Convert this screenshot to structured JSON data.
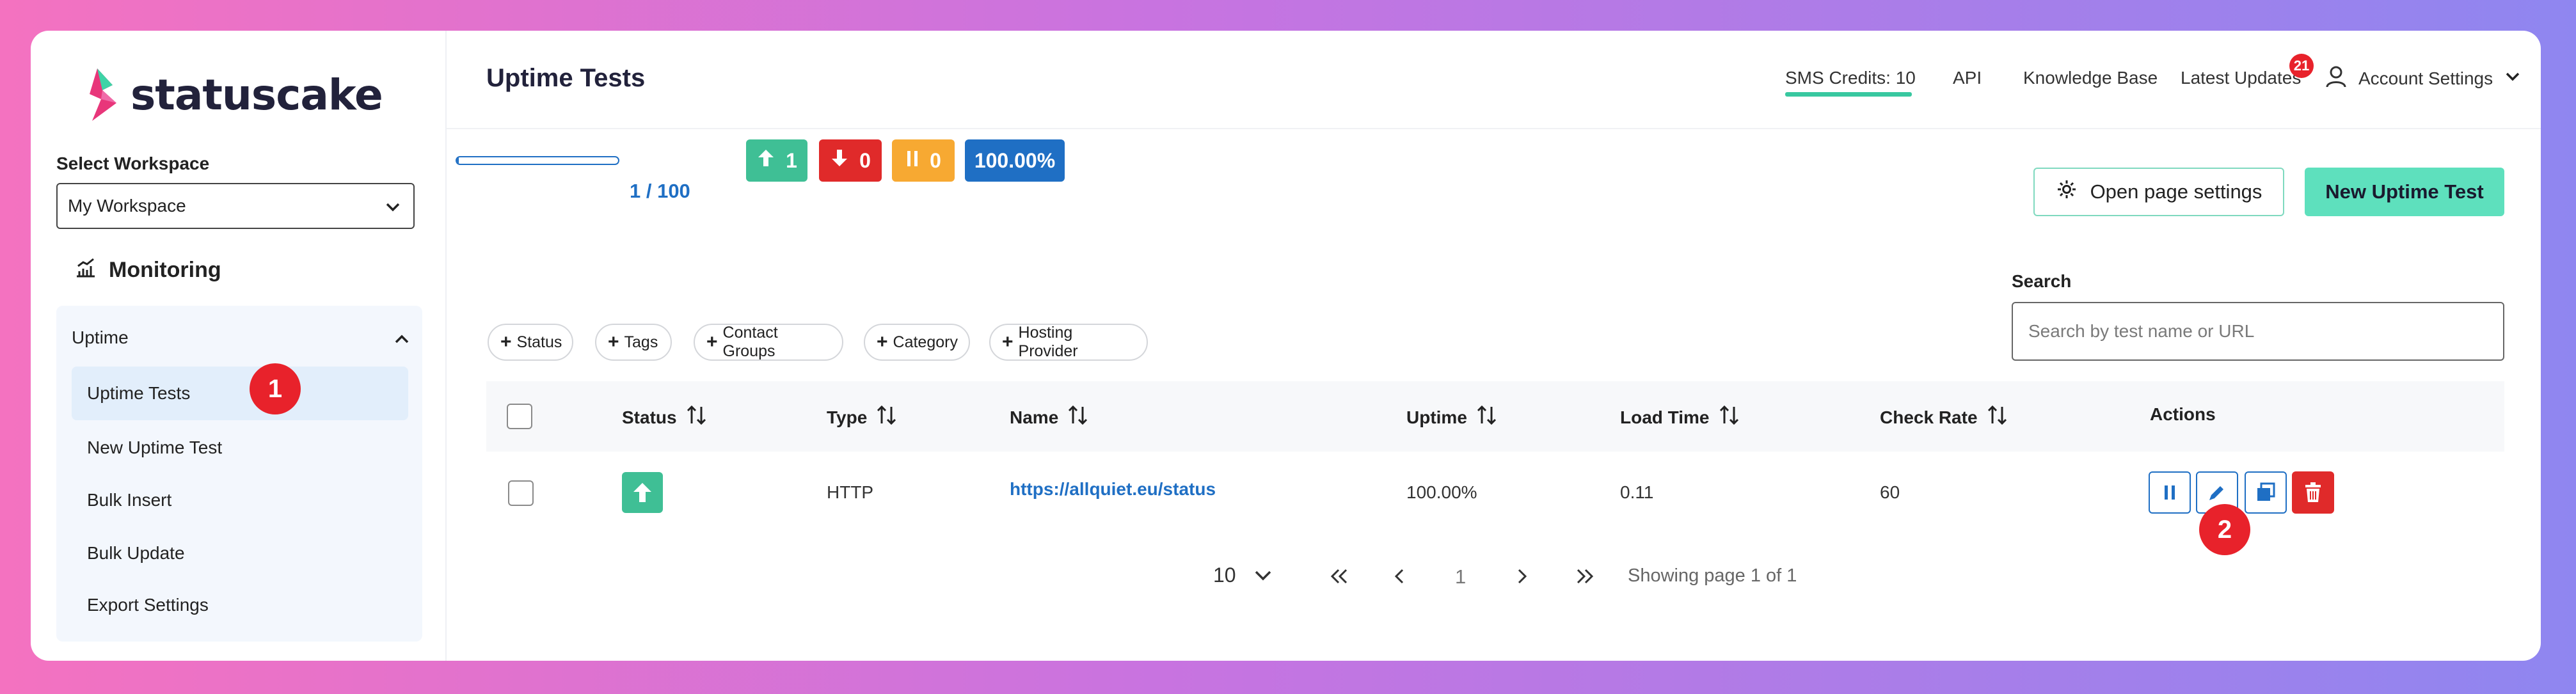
{
  "brand": {
    "name": "statuscake"
  },
  "sidebar": {
    "workspace_label": "Select Workspace",
    "workspace_value": "My Workspace",
    "section_title": "Monitoring",
    "group_label": "Uptime",
    "items": [
      {
        "label": "Uptime Tests",
        "active": true
      },
      {
        "label": "New Uptime Test"
      },
      {
        "label": "Bulk Insert"
      },
      {
        "label": "Bulk Update"
      },
      {
        "label": "Export Settings"
      }
    ]
  },
  "header": {
    "title": "Uptime Tests",
    "sms_credits": "SMS Credits: 10",
    "api": "API",
    "knowledge_base": "Knowledge Base",
    "latest_updates": "Latest Updates",
    "updates_count": "21",
    "account_settings": "Account Settings"
  },
  "stats": {
    "progress_label": "1 / 100",
    "progress_fraction": 0.01,
    "up": "1",
    "down": "0",
    "paused": "0",
    "uptime": "100.00%",
    "colors": {
      "up": "#3fbf95",
      "down": "#e02a2a",
      "paused": "#f7a932",
      "uptime": "#1f6fc4"
    }
  },
  "actions": {
    "open_settings": "Open page settings",
    "new_test": "New Uptime Test"
  },
  "search": {
    "label": "Search",
    "placeholder": "Search by test name or URL"
  },
  "filters": [
    "Status",
    "Tags",
    "Contact Groups",
    "Category",
    "Hosting Provider"
  ],
  "table": {
    "columns": [
      "Status",
      "Type",
      "Name",
      "Uptime",
      "Load Time",
      "Check Rate",
      "Actions"
    ],
    "rows": [
      {
        "status": "up",
        "type": "HTTP",
        "name": "https://allquiet.eu/status",
        "uptime": "100.00%",
        "load_time": "0.11",
        "check_rate": "60"
      }
    ]
  },
  "pagination": {
    "page_size": "10",
    "current_page": "1",
    "summary": "Showing page 1 of 1"
  },
  "markers": [
    "1",
    "2"
  ]
}
